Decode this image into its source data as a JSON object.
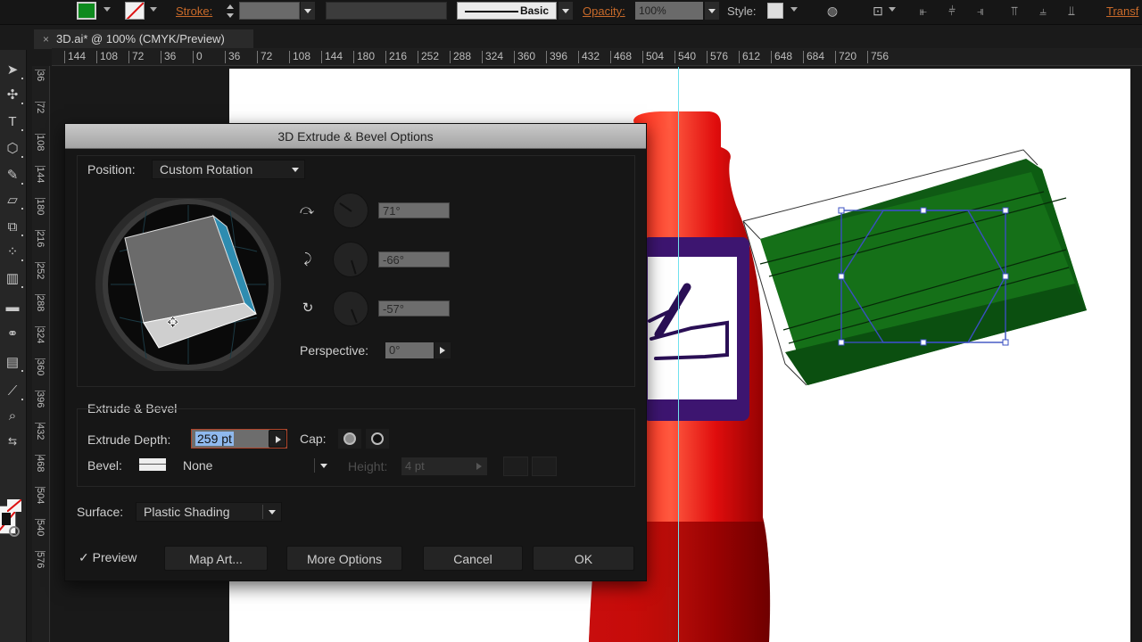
{
  "control_bar": {
    "fill_color": "#0e8a1e",
    "stroke_label": "Stroke:",
    "brush_label": "Basic",
    "opacity_label": "Opacity:",
    "opacity_value": "100%",
    "style_label": "Style:",
    "transform_label": "Transf"
  },
  "document": {
    "tab_title": "3D.ai* @ 100% (CMYK/Preview)",
    "close_glyph": "×"
  },
  "rulers": {
    "horizontal": [
      "144",
      "108",
      "72",
      "36",
      "0",
      "36",
      "72",
      "108",
      "144",
      "180",
      "216",
      "252",
      "288",
      "324",
      "360",
      "396",
      "432",
      "468",
      "504",
      "540",
      "576",
      "612",
      "648",
      "684",
      "720",
      "756"
    ],
    "vertical": [
      "36",
      "72",
      "108",
      "144",
      "180",
      "216",
      "252",
      "288",
      "324",
      "360",
      "396",
      "432",
      "468",
      "504",
      "540",
      "576"
    ]
  },
  "tools": [
    "selection-tool",
    "direct-selection-tool",
    "type-tool",
    "polygon-tool",
    "pencil-tool",
    "eraser-tool",
    "free-transform-tool",
    "symbol-sprayer-tool",
    "column-graph-tool",
    "gradient-tool",
    "blend-tool",
    "chart-tool",
    "eyedropper-tool",
    "zoom-tool",
    "swap-colors"
  ],
  "dialog": {
    "title": "3D Extrude & Bevel Options",
    "position_label": "Position:",
    "position_value": "Custom Rotation",
    "x_rotation": "71°",
    "y_rotation": "-66°",
    "z_rotation": "-57°",
    "x_rotation_deg": 71,
    "y_rotation_deg": -66,
    "z_rotation_deg": -57,
    "perspective_label": "Perspective:",
    "perspective_value": "0°",
    "extrude_section_label": "Extrude & Bevel",
    "extrude_depth_label": "Extrude Depth:",
    "extrude_depth_value": "259 pt",
    "cap_label": "Cap:",
    "bevel_label": "Bevel:",
    "bevel_value": "None",
    "height_label": "Height:",
    "height_value": "4 pt",
    "surface_label": "Surface:",
    "surface_value": "Plastic Shading",
    "preview_label": "Preview",
    "preview_checked": "✓",
    "map_art_label": "Map Art...",
    "more_options_label": "More Options",
    "cancel_label": "Cancel",
    "ok_label": "OK"
  },
  "colors": {
    "bottle_red": "#e01010",
    "label_purple": "#3d1570",
    "extrusion_green": "#136b18",
    "guide_cyan": "#6fe1ee",
    "selection_blue": "#3a4fc0"
  }
}
